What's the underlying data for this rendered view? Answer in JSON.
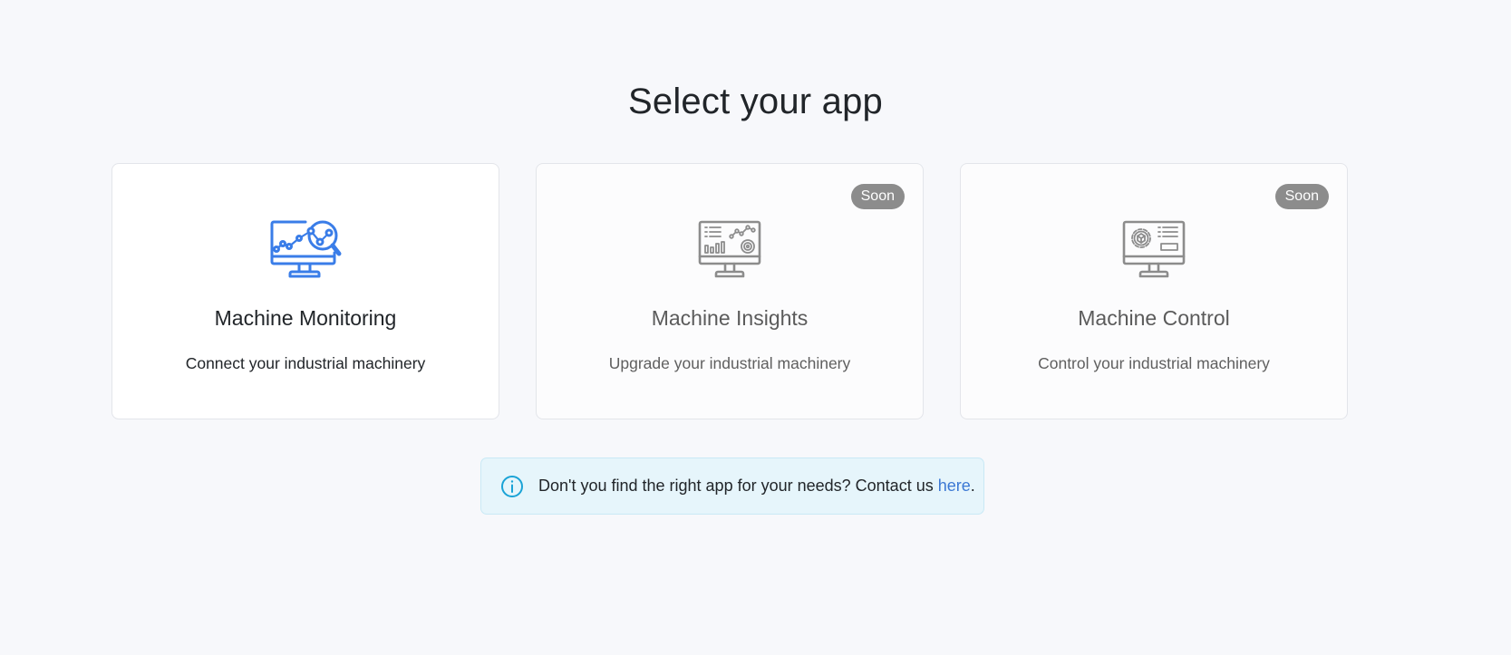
{
  "page": {
    "title": "Select your app"
  },
  "cards": [
    {
      "title": "Machine Monitoring",
      "description": "Connect your industrial machinery",
      "badge": "",
      "icon": "monitor-analytics-search-icon",
      "accent": "#3a7de8"
    },
    {
      "title": "Machine Insights",
      "description": "Upgrade your industrial machinery",
      "badge": "Soon",
      "icon": "monitor-dashboard-icon",
      "accent": "#8c8c8c"
    },
    {
      "title": "Machine Control",
      "description": "Control your industrial machinery",
      "badge": "Soon",
      "icon": "monitor-gear-control-icon",
      "accent": "#8c8c8c"
    }
  ],
  "info": {
    "icon": "info-circle-icon",
    "text": "Don't you find the right app for your needs? Contact us ",
    "link_label": "here",
    "suffix": ".",
    "accent": "#1aa3d6"
  }
}
